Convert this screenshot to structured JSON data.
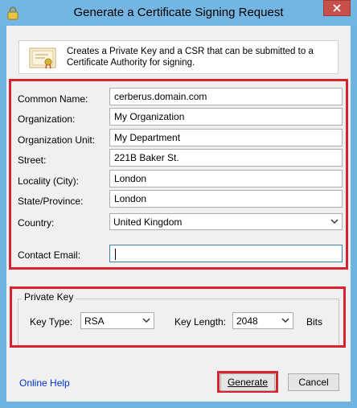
{
  "window": {
    "title": "Generate a Certificate Signing Request",
    "icon": "lock-icon",
    "close_icon": "close-icon"
  },
  "header": {
    "icon": "certificate-icon",
    "text": "Creates a Private Key and a CSR that can be submitted to a Certificate Authority for signing."
  },
  "form": {
    "common_name": {
      "label": "Common Name:",
      "value": "cerberus.domain.com"
    },
    "organization": {
      "label": "Organization:",
      "value": "My Organization"
    },
    "organization_unit": {
      "label": "Organization Unit:",
      "value": "My Department"
    },
    "street": {
      "label": "Street:",
      "value": "221B Baker St."
    },
    "locality": {
      "label": "Locality (City):",
      "value": "London"
    },
    "state": {
      "label": "State/Province:",
      "value": "London"
    },
    "country": {
      "label": "Country:",
      "value": "United Kingdom"
    },
    "contact_email": {
      "label": "Contact Email:",
      "value": ""
    }
  },
  "private_key": {
    "group_label": "Private Key",
    "key_type_label": "Key Type:",
    "key_type_value": "RSA",
    "key_length_label": "Key Length:",
    "key_length_value": "2048",
    "bits_label": "Bits"
  },
  "footer": {
    "online_help": "Online Help",
    "generate": "Generate",
    "cancel": "Cancel"
  },
  "colors": {
    "highlight": "#d6232e",
    "titlebar": "#74b6e3",
    "link": "#0033cc"
  }
}
